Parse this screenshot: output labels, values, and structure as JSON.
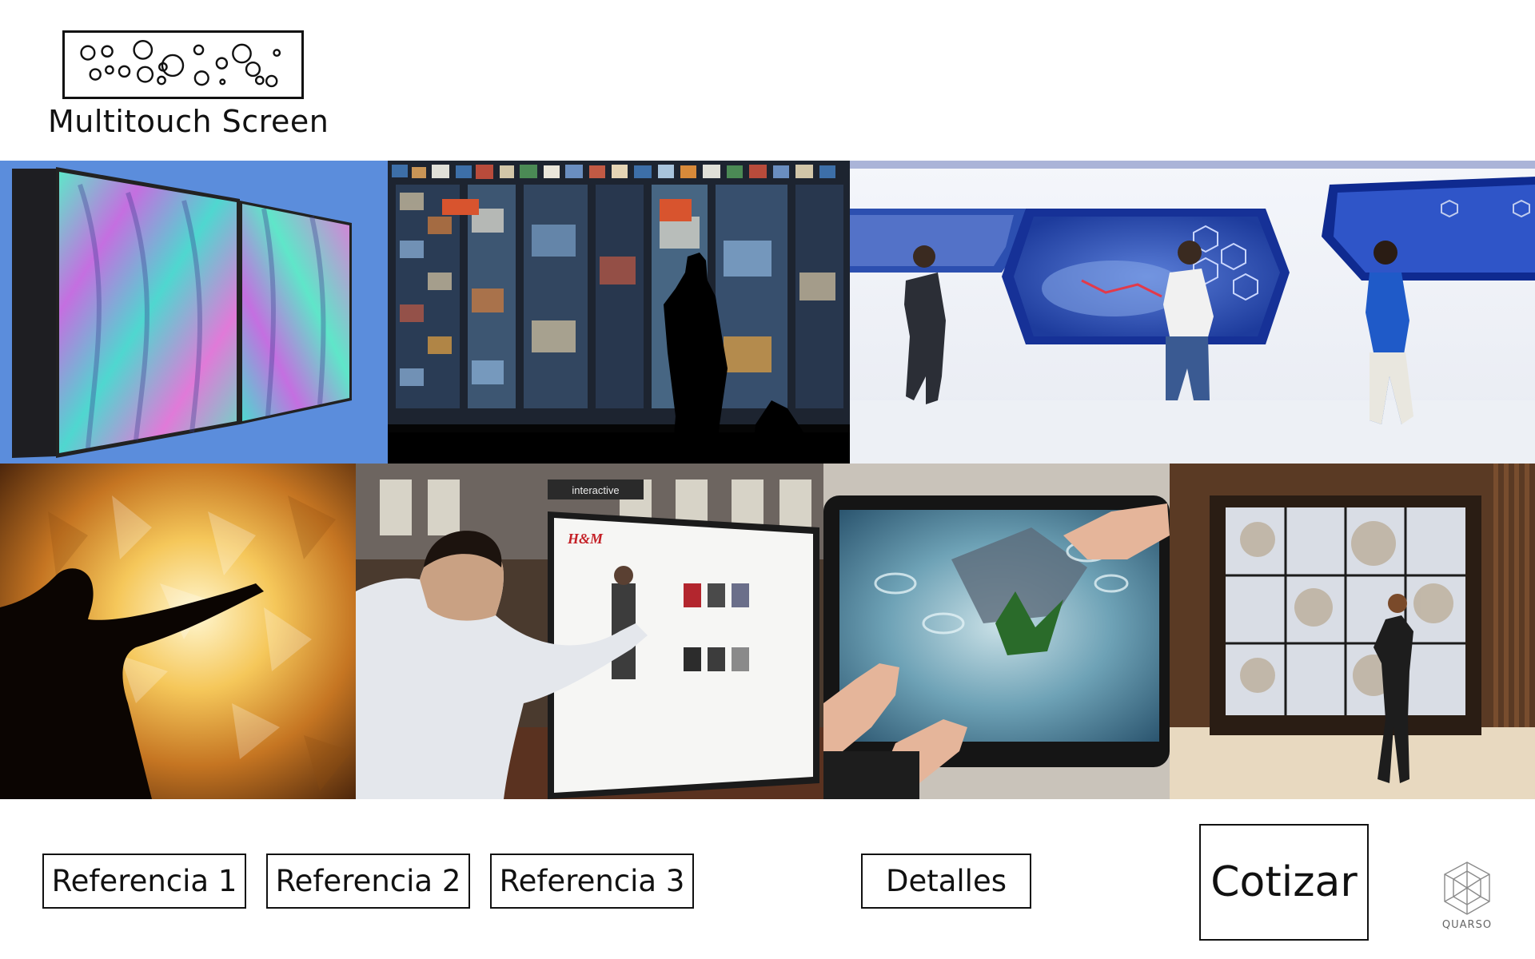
{
  "header": {
    "title": "Multitouch Screen",
    "logo_icon": "touch-dots-logo-icon"
  },
  "gallery": {
    "images": [
      {
        "name": "dual-panel-gradient-display"
      },
      {
        "name": "photo-wall-interactive-display"
      },
      {
        "name": "airport-hexagon-touch-walls"
      },
      {
        "name": "person-silhouette-crystal-screen"
      },
      {
        "name": "hm-interactive-kiosk"
      },
      {
        "name": "hands-on-multitouch-table"
      },
      {
        "name": "watch-store-video-wall"
      }
    ],
    "hm_sign": "interactive",
    "hm_brand": "H&M"
  },
  "buttons": {
    "ref1": "Referencia 1",
    "ref2": "Referencia 2",
    "ref3": "Referencia 3",
    "details": "Detalles",
    "quote": "Cotizar"
  },
  "brand": {
    "name": "QUARSO",
    "icon": "quarso-geodesic-icon"
  },
  "colors": {
    "background": "#ffffff",
    "border": "#111111",
    "brand_text": "#666666"
  }
}
